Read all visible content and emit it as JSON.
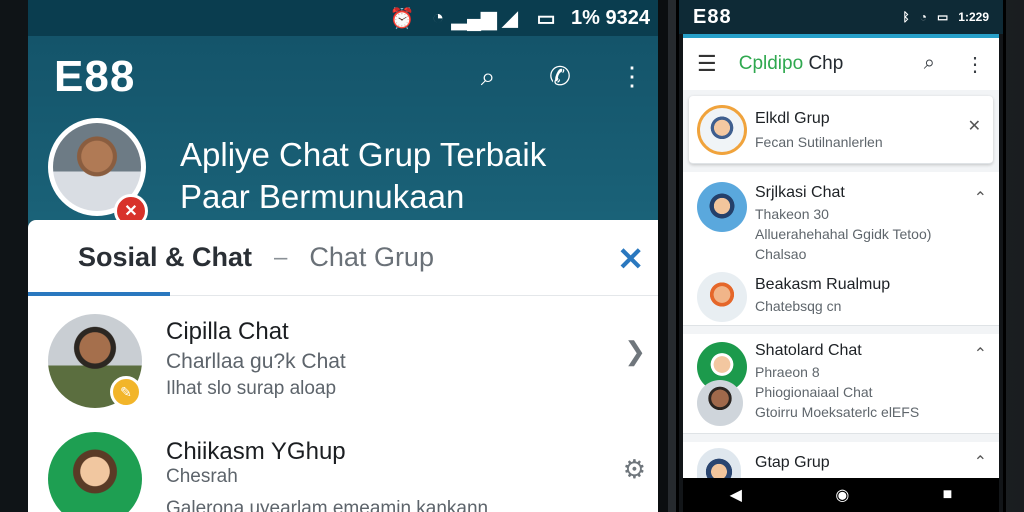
{
  "left": {
    "status": {
      "right_text": "1% 9324"
    },
    "brand": "E88",
    "header_icons": [
      "search-icon",
      "phone-icon",
      "more-icon"
    ],
    "headline": [
      "Apliye Chat Grup Terbaik",
      "Paar Bermunukaan"
    ],
    "tabs": {
      "active": "Sosial & Chat",
      "separator": "–",
      "other": "Chat Grup"
    },
    "rows": [
      {
        "title": "Cipilla Chat",
        "sub1": "Charllaa gu?k Chat",
        "sub2": "Ilhat slo surap aloap",
        "icon": "forward-icon"
      },
      {
        "title": "Chiikasm YGhup",
        "sub1": "Chesrah",
        "sub2": "Galerona uyearlam emeamin kankann",
        "icon": "gear-icon"
      }
    ]
  },
  "right": {
    "status": {
      "left_text": "E88",
      "right_text": "1:229"
    },
    "appbar": {
      "title_prefix": "Cpldipo",
      "title_suffix": "Chp"
    },
    "cards": [
      {
        "title": "Elkdl Grup",
        "sub": "Fecan Sutilnanlerlen",
        "icon": "close-icon"
      },
      {
        "title": "Srjlkasi Chat",
        "sub1": "Thakeon 30",
        "sub2": "Alluerahehahal Ggidk Tetoo)",
        "sub3": "Chalsao",
        "icon": "chevron-up-icon"
      },
      {
        "title": "Beakasm Rualmup",
        "sub1": "Chatebsqg cn",
        "icon": ""
      },
      {
        "title": "Shatolard Chat",
        "sub1": "Phraeon 8",
        "sub2": "Phiogionaiaal Chat",
        "sub3": "Gtoirru Moeksaterlc elEFS",
        "icon": "chevron-up-icon"
      },
      {
        "title": "Gtap Grup",
        "icon": "chevron-up-icon"
      }
    ],
    "nav": [
      "back-icon",
      "home-icon",
      "recents-icon"
    ]
  }
}
